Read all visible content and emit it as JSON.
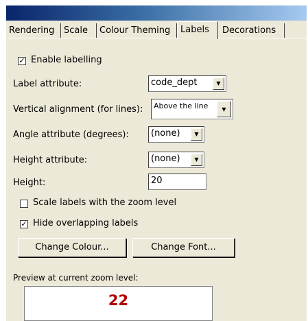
{
  "tabs": [
    {
      "label": "Rendering",
      "active": false
    },
    {
      "label": "Scale",
      "active": false
    },
    {
      "label": "Colour Theming",
      "active": false
    },
    {
      "label": "Labels",
      "active": true
    },
    {
      "label": "Decorations",
      "active": false
    }
  ],
  "enable_labelling": {
    "label": "Enable labelling",
    "checked": true
  },
  "label_attribute": {
    "label": "Label attribute:",
    "value": "code_dept"
  },
  "vertical_alignment": {
    "label": "Vertical alignment (for lines):",
    "value": "Above the line"
  },
  "angle_attribute": {
    "label": "Angle attribute (degrees):",
    "value": "(none)"
  },
  "height_attribute": {
    "label": "Height attribute:",
    "value": "(none)"
  },
  "height": {
    "label": "Height:",
    "value": "20"
  },
  "scale_labels": {
    "label": "Scale labels with the zoom level",
    "checked": false
  },
  "hide_overlapping": {
    "label": "Hide overlapping labels",
    "checked": true
  },
  "buttons": {
    "change_colour": "Change Colour...",
    "change_font": "Change Font..."
  },
  "preview": {
    "label": "Preview at current zoom level:",
    "value": "22",
    "color": "#b00000"
  },
  "icons": {
    "checkmark": "check-icon",
    "dropdown": "dropdown-arrow-icon"
  }
}
